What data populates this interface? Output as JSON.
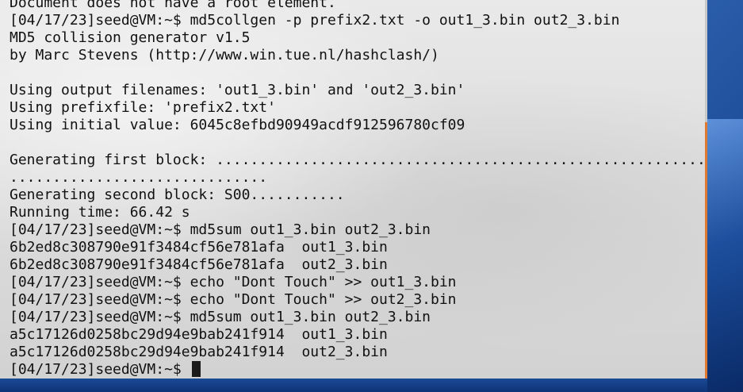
{
  "terminal": {
    "lines": [
      "Document does not have a root element.",
      "[04/17/23]seed@VM:~$ md5collgen -p prefix2.txt -o out1_3.bin out2_3.bin",
      "MD5 collision generator v1.5",
      "by Marc Stevens (http://www.win.tue.nl/hashclash/)",
      "",
      "Using output filenames: 'out1_3.bin' and 'out2_3.bin'",
      "Using prefixfile: 'prefix2.txt'",
      "Using initial value: 6045c8efbd90949acdf912596780cf09",
      "",
      "Generating first block: ..................................................................................",
      "..............................",
      "Generating second block: S00...........",
      "Running time: 66.42 s",
      "[04/17/23]seed@VM:~$ md5sum out1_3.bin out2_3.bin",
      "6b2ed8c308790e91f3484cf56e781afa  out1_3.bin",
      "6b2ed8c308790e91f3484cf56e781afa  out2_3.bin",
      "[04/17/23]seed@VM:~$ echo \"Dont Touch\" >> out1_3.bin",
      "[04/17/23]seed@VM:~$ echo \"Dont Touch\" >> out2_3.bin",
      "[04/17/23]seed@VM:~$ md5sum out1_3.bin out2_3.bin",
      "a5c17126d0258bc29d94e9bab241f914  out1_3.bin",
      "a5c17126d0258bc29d94e9bab241f914  out2_3.bin"
    ],
    "prompt": "[04/17/23]seed@VM:~$ "
  },
  "colors": {
    "text": "#111111",
    "scroll_thumb": "#e07a30",
    "desktop": "#2a5aa8"
  }
}
